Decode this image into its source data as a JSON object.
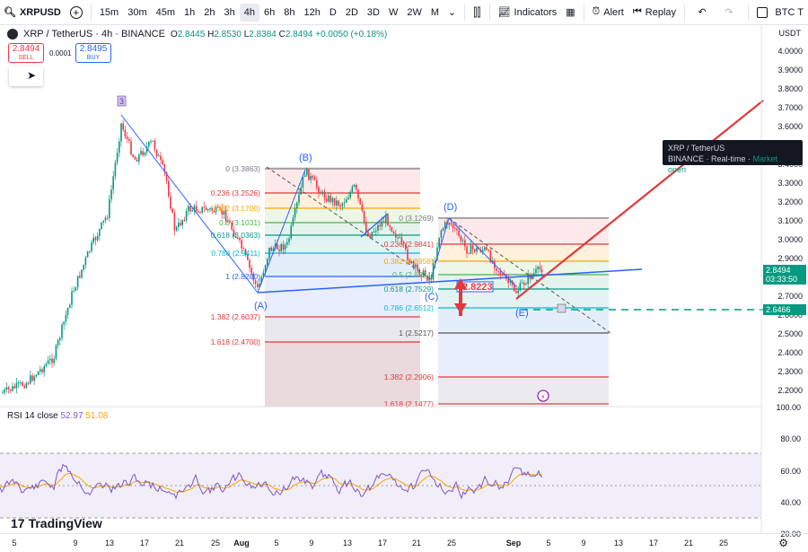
{
  "toolbar": {
    "symbol": "XRPUSD",
    "intervals": [
      "15m",
      "30m",
      "45m",
      "1h",
      "2h",
      "3h",
      "4h",
      "6h",
      "8h",
      "12h",
      "D",
      "2D",
      "3D",
      "W",
      "2W",
      "M"
    ],
    "active_interval": "4h",
    "indicators_label": "Indicators",
    "alert_label": "Alert",
    "replay_label": "Replay",
    "compare_label": "BTC T"
  },
  "legend": {
    "title": "XRP / TetherUS · 4h · BINANCE",
    "o_key": "O",
    "o": "2.8445",
    "h_key": "H",
    "h": "2.8530",
    "l_key": "L",
    "l": "2.8384",
    "c_key": "C",
    "c": "2.8494",
    "change": "+0.0050 (+0.18%)",
    "sell_price": "2.8494",
    "sell_label": "SELL",
    "buy_price": "2.8495",
    "buy_label": "BUY",
    "spread": "0.0001"
  },
  "price_axis": {
    "currency": "USDT",
    "labels": [
      "4.0000",
      "3.9000",
      "3.8000",
      "3.7000",
      "3.6000",
      "3.5000",
      "3.4000",
      "3.3000",
      "3.2000",
      "3.1000",
      "3.0000",
      "2.9000",
      "2.8000",
      "2.7000",
      "2.6000",
      "2.5000",
      "2.4000",
      "2.3000",
      "2.2000"
    ],
    "current_price": "2.8494",
    "countdown": "03:33:50",
    "target_price": "2.6466"
  },
  "tooltip": {
    "line1": "XRP / TetherUS",
    "exchange": "BINANCE",
    "status": "Real-time",
    "market": "Market open"
  },
  "annotations": {
    "wave_a": "(A)",
    "wave_b": "(B)",
    "wave_c": "(C)",
    "wave_d": "(D)",
    "wave_e": "(E)",
    "marker_3": "3",
    "fib1": [
      "0 (3.3863)",
      "0.236 (3.2526)",
      "0.382 (3.1700)",
      "0.5 (3.1031)",
      "0.618 (3.0363)",
      "0.786 (2.9411)",
      "1 (2.8200)",
      "1.382 (2.6037)",
      "1.618 (2.4700)"
    ],
    "fib2": [
      "0 (3.1269)",
      "0.236 (2.9841)",
      "0.382 (2.8958)",
      "0.5 (2.8244)",
      "0.618 (2.7529)",
      "0.786 (2.6512)",
      "1 (2.5217)",
      "1.382 (2.2906)",
      "1.618 (2.1477)"
    ],
    "box_price": "2.8223"
  },
  "rsi": {
    "title": "RSI 14 close",
    "value1": "52.97",
    "value2": "51.08",
    "levels": [
      "100.00",
      "80.00",
      "60.00",
      "40.00",
      "20.00"
    ]
  },
  "branding": {
    "logo_text": "TradingView",
    "logo_mark": "17"
  },
  "time_axis": {
    "labels": [
      "5",
      "9",
      "13",
      "17",
      "21",
      "25",
      "Aug",
      "5",
      "9",
      "13",
      "17",
      "21",
      "25",
      "Sep",
      "5",
      "9",
      "13",
      "17",
      "21",
      "25"
    ]
  },
  "colors": {
    "up": "#089981",
    "down": "#f23645",
    "fib_blue": "#2962ff",
    "rsi": "#7e57c2",
    "rsi_ma": "#f7a600"
  }
}
